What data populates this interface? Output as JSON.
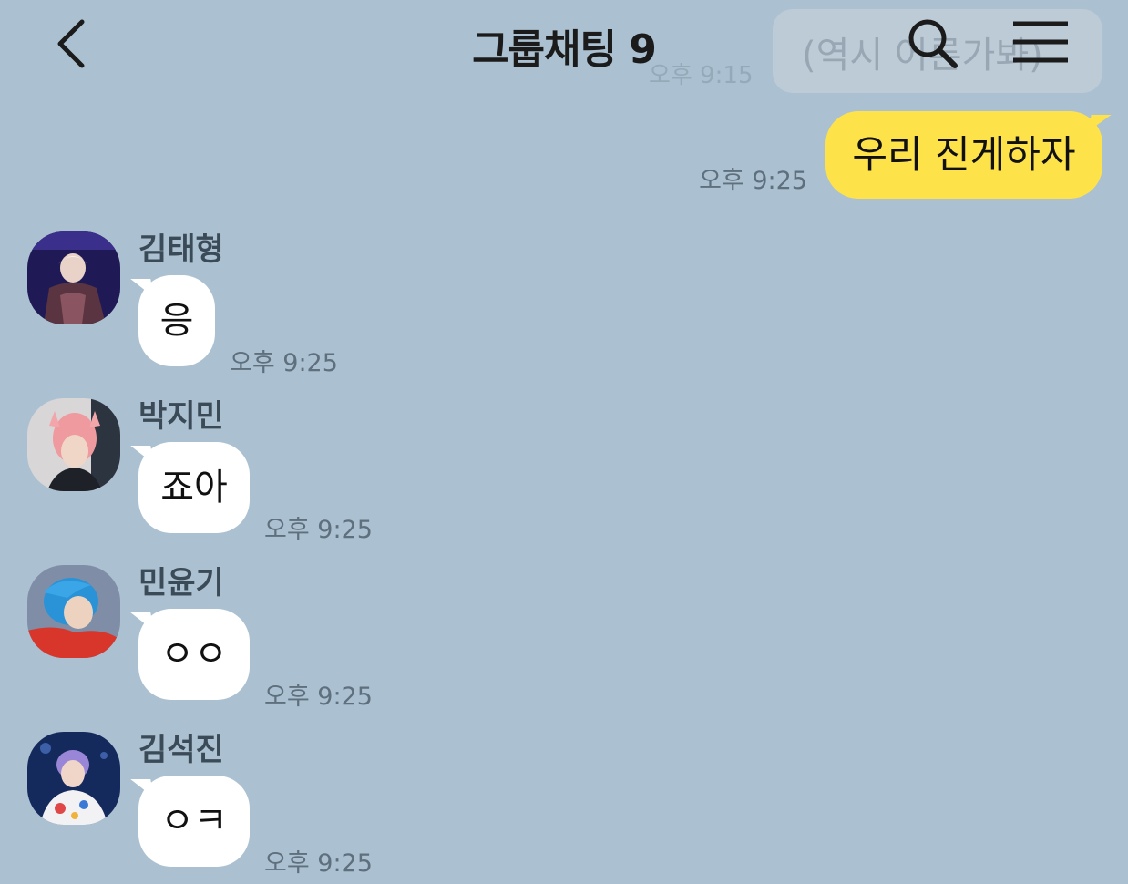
{
  "header": {
    "title": "그룹채팅 9",
    "back_icon": "chevron-left-icon",
    "search_icon": "search-icon",
    "menu_icon": "hamburger-menu-icon",
    "ghost_message": "(역시 어른가봐)",
    "ghost_time": "오후 9:15"
  },
  "colors": {
    "background": "#abc1d1",
    "my_bubble": "#fee24a",
    "friend_bubble": "#ffffff",
    "time_text": "#5e6f7e"
  },
  "my_message": {
    "text": "우리 진게하자",
    "time": "오후 9:25"
  },
  "messages": [
    {
      "sender": "김태형",
      "text": "응",
      "time": "오후 9:25",
      "avatar": "profile-photo"
    },
    {
      "sender": "박지민",
      "text": "죠아",
      "time": "오후 9:25",
      "avatar": "profile-photo"
    },
    {
      "sender": "민윤기",
      "text": "ㅇㅇ",
      "time": "오후 9:25",
      "avatar": "profile-photo"
    },
    {
      "sender": "김석진",
      "text": "ㅇㅋ",
      "time": "오후 9:25",
      "avatar": "profile-photo"
    }
  ]
}
